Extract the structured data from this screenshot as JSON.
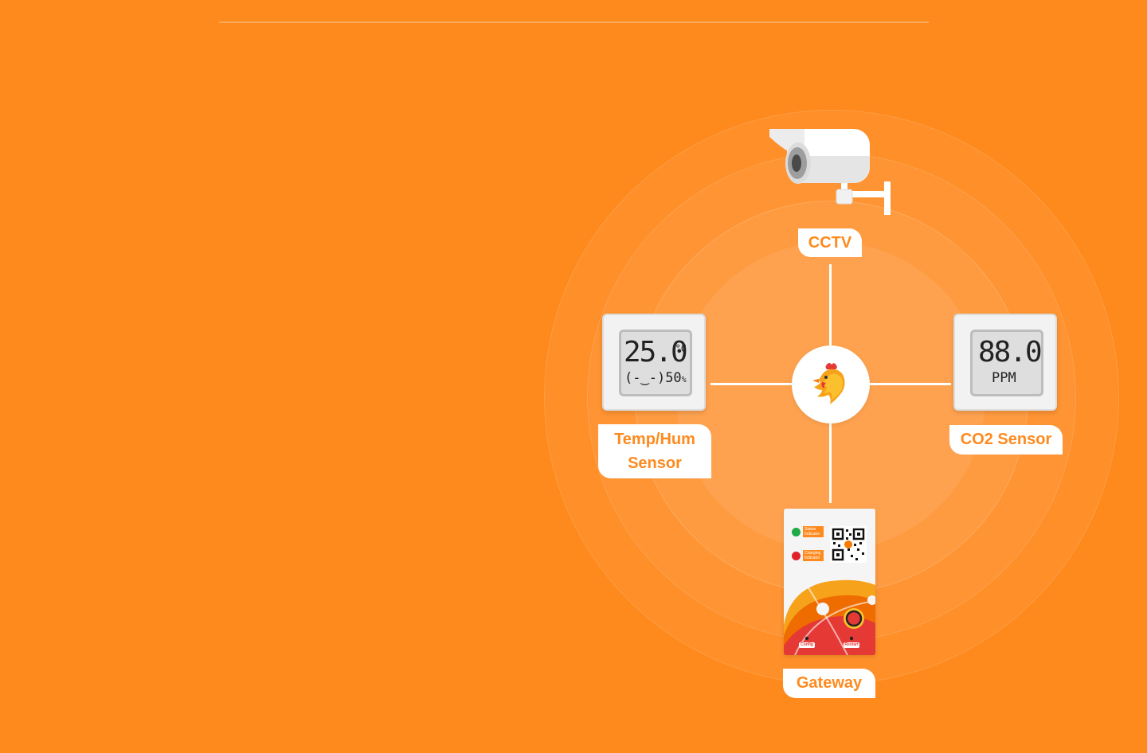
{
  "diagram": {
    "hub": {
      "icon": "rooster-logo-icon"
    },
    "nodes": {
      "cctv": {
        "label": "CCTV",
        "icon": "cctv-camera-icon"
      },
      "temp_hum": {
        "label_line1": "Temp/Hum",
        "label_line2": "Sensor",
        "display_value": "25.0",
        "display_unit": "°C",
        "display_face": "(-‿-)",
        "display_humidity": "50",
        "display_humidity_unit": "%"
      },
      "co2": {
        "label": "CO2 Sensor",
        "display_value": "88.0",
        "display_unit": "PPM"
      },
      "gateway": {
        "label": "Gateway",
        "status_label": "Status Indicator",
        "charging_label": "Charging Indicator",
        "config_label": "Config",
        "restart_label": "Restart"
      }
    }
  },
  "colors": {
    "background": "#fe8a1e",
    "accent": "#fe8a1e",
    "status_led": "#1faa46",
    "charging_led": "#e0202a"
  }
}
